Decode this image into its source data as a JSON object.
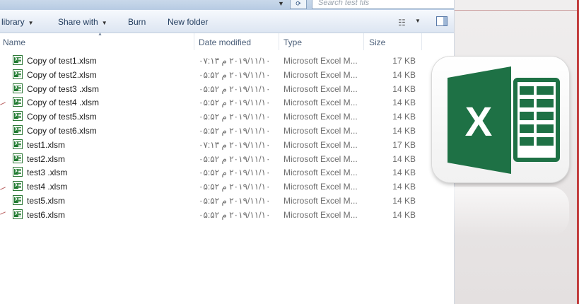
{
  "search": {
    "placeholder": "Search test fils"
  },
  "toolbar": {
    "library_label": "library",
    "share_label": "Share with",
    "burn_label": "Burn",
    "new_folder_label": "New folder"
  },
  "columns": {
    "name": "Name",
    "date": "Date modified",
    "type": "Type",
    "size": "Size"
  },
  "files": [
    {
      "name": "Copy of test1.xlsm",
      "date": "۲۰۱۹/۱۱/۱۰ م ۰۷:۱۳",
      "type": "Microsoft Excel M...",
      "size": "17 KB"
    },
    {
      "name": "Copy of test2.xlsm",
      "date": "۲۰۱۹/۱۱/۱۰ م ۰۵:۵۲",
      "type": "Microsoft Excel M...",
      "size": "14 KB"
    },
    {
      "name": "Copy of test3 .xlsm",
      "date": "۲۰۱۹/۱۱/۱۰ م ۰۵:۵۲",
      "type": "Microsoft Excel M...",
      "size": "14 KB"
    },
    {
      "name": "Copy of test4 .xlsm",
      "date": "۲۰۱۹/۱۱/۱۰ م ۰۵:۵۲",
      "type": "Microsoft Excel M...",
      "size": "14 KB"
    },
    {
      "name": "Copy of test5.xlsm",
      "date": "۲۰۱۹/۱۱/۱۰ م ۰۵:۵۲",
      "type": "Microsoft Excel M...",
      "size": "14 KB"
    },
    {
      "name": "Copy of test6.xlsm",
      "date": "۲۰۱۹/۱۱/۱۰ م ۰۵:۵۲",
      "type": "Microsoft Excel M...",
      "size": "14 KB"
    },
    {
      "name": "test1.xlsm",
      "date": "۲۰۱۹/۱۱/۱۰ م ۰۷:۱۳",
      "type": "Microsoft Excel M...",
      "size": "17 KB"
    },
    {
      "name": "test2.xlsm",
      "date": "۲۰۱۹/۱۱/۱۰ م ۰۵:۵۲",
      "type": "Microsoft Excel M...",
      "size": "14 KB"
    },
    {
      "name": "test3 .xlsm",
      "date": "۲۰۱۹/۱۱/۱۰ م ۰۵:۵۲",
      "type": "Microsoft Excel M...",
      "size": "14 KB"
    },
    {
      "name": "test4 .xlsm",
      "date": "۲۰۱۹/۱۱/۱۰ م ۰۵:۵۲",
      "type": "Microsoft Excel M...",
      "size": "14 KB"
    },
    {
      "name": "test5.xlsm",
      "date": "۲۰۱۹/۱۱/۱۰ م ۰۵:۵۲",
      "type": "Microsoft Excel M...",
      "size": "14 KB"
    },
    {
      "name": "test6.xlsm",
      "date": "۲۰۱۹/۱۱/۱۰ م ۰۵:۵۲",
      "type": "Microsoft Excel M...",
      "size": "14 KB"
    }
  ],
  "logo": {
    "letter": "X",
    "icon": "excel-logo-icon",
    "color": "#1e7145"
  },
  "colors": {
    "toolbar_text": "#1e395b",
    "excel_green": "#1e7145",
    "accent_red": "#c13b3b"
  }
}
